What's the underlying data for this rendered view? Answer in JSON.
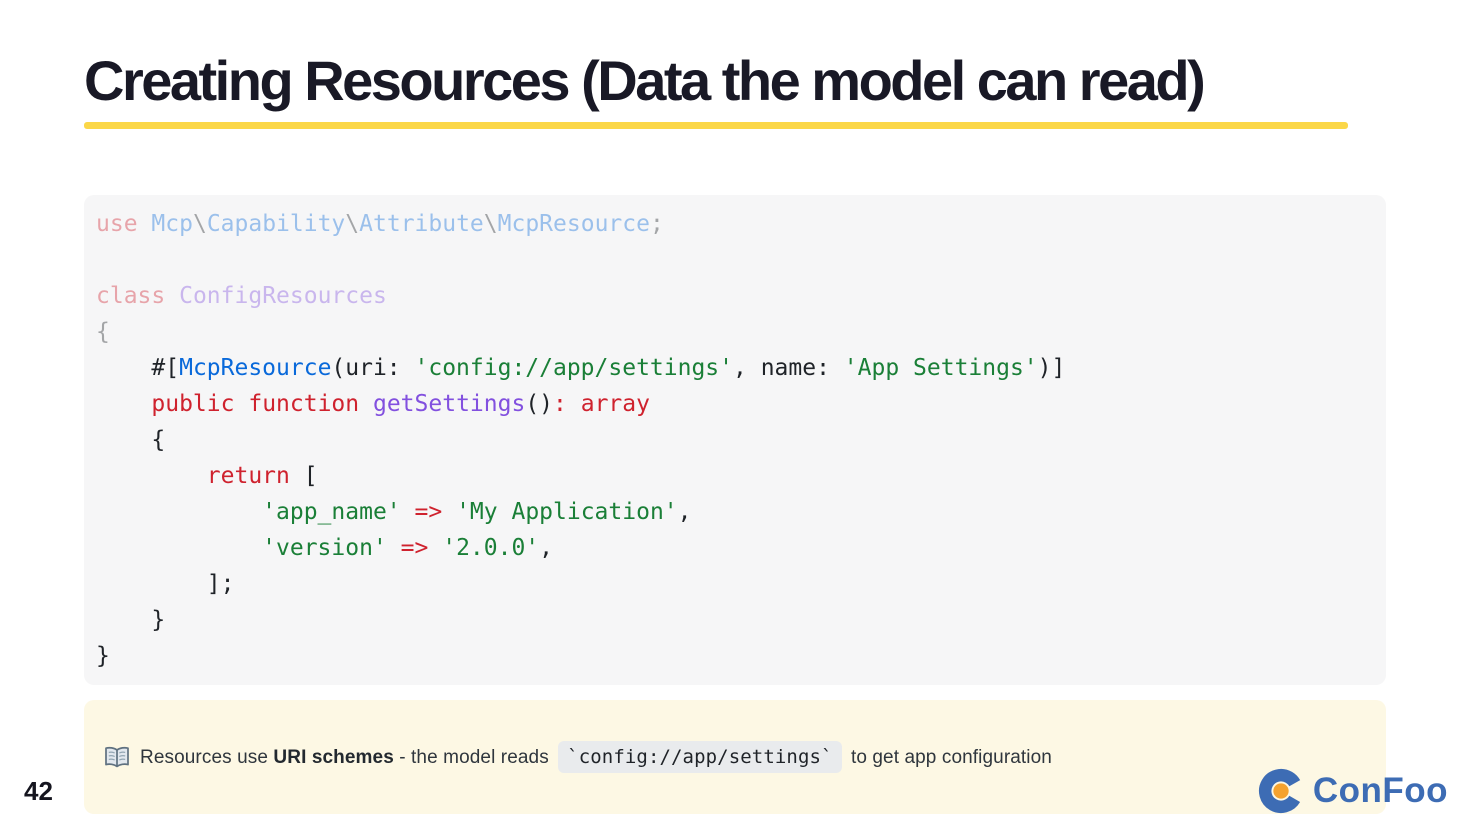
{
  "slide": {
    "title": "Creating Resources (Data the model can read)",
    "page_number": "42",
    "accent_underline_color": "#fbd748",
    "background_color": "#ffffff"
  },
  "code_block": {
    "language": "php",
    "background_color": "#f6f6f7",
    "syntax_colors": {
      "keyword": "#cf222e",
      "type": "#0969da",
      "function": "#8250df",
      "string": "#1a7f37",
      "plain": "#1f2328"
    },
    "lines": [
      {
        "faded": true,
        "tokens": [
          {
            "c": "k",
            "t": "use"
          },
          {
            "c": "p",
            "t": " "
          },
          {
            "c": "t",
            "t": "Mcp"
          },
          {
            "c": "p",
            "t": "\\"
          },
          {
            "c": "t",
            "t": "Capability"
          },
          {
            "c": "p",
            "t": "\\"
          },
          {
            "c": "t",
            "t": "Attribute"
          },
          {
            "c": "p",
            "t": "\\"
          },
          {
            "c": "t",
            "t": "McpResource"
          },
          {
            "c": "p",
            "t": ";"
          }
        ]
      },
      {
        "faded": true,
        "tokens": []
      },
      {
        "faded": true,
        "tokens": [
          {
            "c": "k",
            "t": "class"
          },
          {
            "c": "p",
            "t": " "
          },
          {
            "c": "f",
            "t": "ConfigResources"
          }
        ]
      },
      {
        "faded": true,
        "tokens": [
          {
            "c": "p",
            "t": "{"
          }
        ]
      },
      {
        "faded": false,
        "tokens": [
          {
            "c": "p",
            "t": "    #["
          },
          {
            "c": "t",
            "t": "McpResource"
          },
          {
            "c": "p",
            "t": "(uri: "
          },
          {
            "c": "s",
            "t": "'config://app/settings'"
          },
          {
            "c": "p",
            "t": ", name: "
          },
          {
            "c": "s",
            "t": "'App Settings'"
          },
          {
            "c": "p",
            "t": ")]"
          }
        ]
      },
      {
        "faded": false,
        "tokens": [
          {
            "c": "p",
            "t": "    "
          },
          {
            "c": "k",
            "t": "public"
          },
          {
            "c": "p",
            "t": " "
          },
          {
            "c": "k",
            "t": "function"
          },
          {
            "c": "p",
            "t": " "
          },
          {
            "c": "f",
            "t": "getSettings"
          },
          {
            "c": "p",
            "t": "()"
          },
          {
            "c": "k",
            "t": ":"
          },
          {
            "c": "p",
            "t": " "
          },
          {
            "c": "k",
            "t": "array"
          }
        ]
      },
      {
        "faded": false,
        "tokens": [
          {
            "c": "p",
            "t": "    {"
          }
        ]
      },
      {
        "faded": false,
        "tokens": [
          {
            "c": "p",
            "t": "        "
          },
          {
            "c": "k",
            "t": "return"
          },
          {
            "c": "p",
            "t": " ["
          }
        ]
      },
      {
        "faded": false,
        "tokens": [
          {
            "c": "p",
            "t": "            "
          },
          {
            "c": "s",
            "t": "'app_name'"
          },
          {
            "c": "p",
            "t": " "
          },
          {
            "c": "k",
            "t": "=>"
          },
          {
            "c": "p",
            "t": " "
          },
          {
            "c": "s",
            "t": "'My Application'"
          },
          {
            "c": "p",
            "t": ","
          }
        ]
      },
      {
        "faded": false,
        "tokens": [
          {
            "c": "p",
            "t": "            "
          },
          {
            "c": "s",
            "t": "'version'"
          },
          {
            "c": "p",
            "t": " "
          },
          {
            "c": "k",
            "t": "=>"
          },
          {
            "c": "p",
            "t": " "
          },
          {
            "c": "s",
            "t": "'2.0.0'"
          },
          {
            "c": "p",
            "t": ","
          }
        ]
      },
      {
        "faded": false,
        "tokens": [
          {
            "c": "p",
            "t": "        ];"
          }
        ]
      },
      {
        "faded": false,
        "tokens": [
          {
            "c": "p",
            "t": "    }"
          }
        ]
      },
      {
        "faded": false,
        "tokens": [
          {
            "c": "p",
            "t": "}"
          }
        ]
      }
    ]
  },
  "note": {
    "icon": "open-book-icon",
    "background_color": "#fdf8e4",
    "segments": [
      {
        "style": "regular",
        "text": "Resources use "
      },
      {
        "style": "bold",
        "text": "URI schemes"
      },
      {
        "style": "regular",
        "text": " - the model reads "
      },
      {
        "style": "code",
        "text": "`config://app/settings`"
      },
      {
        "style": "regular",
        "text": " to get app configuration"
      }
    ]
  },
  "logo": {
    "text": "ConFoo",
    "blue": "#3d6cb4",
    "orange": "#f5a22e"
  }
}
